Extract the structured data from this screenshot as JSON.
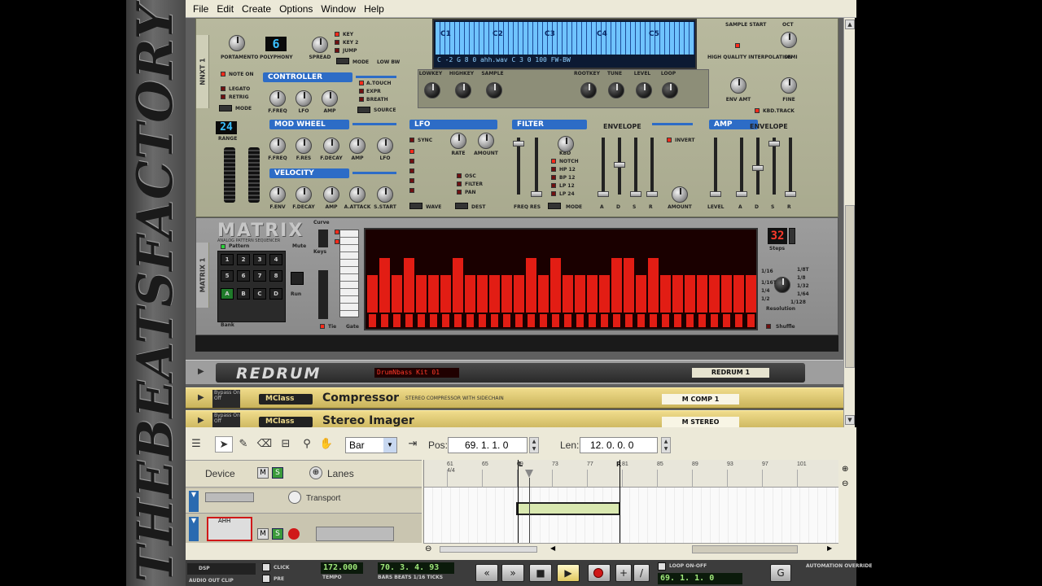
{
  "watermark": "THEBEATSFACTORY",
  "menu": [
    "File",
    "Edit",
    "Create",
    "Options",
    "Window",
    "Help"
  ],
  "nnxt": {
    "side_label": "NNXT 1",
    "knob_labels": [
      "PORTAMENTO",
      "POLYPHONY",
      "SPREAD"
    ],
    "polyphony": "6",
    "key_modes": [
      "KEY",
      "KEY 2",
      "JUMP"
    ],
    "mode_labels": [
      "MODE",
      "LOW BW"
    ],
    "note_on": "NOTE ON",
    "legato": "LEGATO",
    "retrig": "RETRIG",
    "mode": "MODE",
    "controller_title": "CONTROLLER",
    "controller_knobs": [
      "F.FREQ",
      "LFO",
      "AMP"
    ],
    "controller_sources": [
      "A.TOUCH",
      "EXPR",
      "BREATH"
    ],
    "source": "SOURCE",
    "range_value": "24",
    "range_label": "RANGE",
    "modwheel_title": "MOD WHEEL",
    "modwheel_knobs": [
      "F.FREQ",
      "F.RES",
      "F.DECAY",
      "AMP",
      "LFO"
    ],
    "velocity_title": "VELOCITY",
    "velocity_knobs": [
      "F.ENV",
      "F.DECAY",
      "AMP",
      "A.ATTACK",
      "S.START"
    ],
    "keyboard_notes": [
      "C1",
      "C2",
      "C3",
      "C4",
      "C5"
    ],
    "keyboard_readout": "C -2  G 8   0 ahh.wav       C 3  0    100 FW-BW",
    "zone_knobs": [
      "LOWKEY",
      "HIGHKEY",
      "SAMPLE",
      "ROOTKEY",
      "TUNE",
      "LEVEL",
      "LOOP"
    ],
    "sample_start": "SAMPLE START",
    "oct": "OCT",
    "hq": "HIGH QUALITY INTERPOLATION",
    "semi": "SEMI",
    "env_amt": "ENV AMT",
    "fine": "FINE",
    "kbd_track": "KBD.TRACK",
    "lfo_title": "LFO",
    "lfo_sync": "SYNC",
    "lfo_knobs": [
      "RATE",
      "AMOUNT"
    ],
    "lfo_dest": [
      "OSC",
      "FILTER",
      "PAN"
    ],
    "lfo_waves": "WAVE",
    "lfo_dest_label": "DEST",
    "filter_title": "FILTER",
    "filter_envelope": "ENVELOPE",
    "filter_kbd": "KBD",
    "filter_modes": [
      "NOTCH",
      "HP 12",
      "BP 12",
      "LP 12",
      "LP 24"
    ],
    "filter_freq": "FREQ RES",
    "filter_mode": "MODE",
    "invert": "INVERT",
    "adsr": [
      "A",
      "D",
      "S",
      "R"
    ],
    "amount": "AMOUNT",
    "amp_title": "AMP",
    "amp_envelope": "ENVELOPE",
    "level": "LEVEL"
  },
  "matrix": {
    "side_label": "MATRIX 1",
    "logo": "MATRIX",
    "subtitle": "ANALOG PATTERN SEQUENCER",
    "pattern_label": "Pattern",
    "mute_label": "Mute",
    "curve_label": "Curve",
    "keys_label": "Keys",
    "run_label": "Run",
    "bank_label": "Bank",
    "tie_label": "Tie",
    "gate_label": "Gate",
    "pads": [
      "1",
      "2",
      "3",
      "4",
      "5",
      "6",
      "7",
      "8",
      "A",
      "B",
      "C",
      "D"
    ],
    "steps": "32",
    "steps_label": "Steps",
    "resolution_label": "Resolution",
    "shuffle_label": "Shuffle",
    "resolution_values": [
      "1/16",
      "1/8T",
      "1/16T",
      "1/8",
      "1/32",
      "1/4",
      "1/64",
      "1/2",
      "1/128"
    ],
    "column_levels": [
      0.55,
      0.8,
      0.55,
      0.8,
      0.55,
      0.55,
      0.55,
      0.8,
      0.55,
      0.55,
      0.55,
      0.55,
      0.55,
      0.8,
      0.55,
      0.8,
      0.55,
      0.55,
      0.55,
      0.55,
      0.8,
      0.8,
      0.55,
      0.8,
      0.55,
      0.55,
      0.55,
      0.55,
      0.55,
      0.55,
      0.55,
      0.55
    ]
  },
  "redrum": {
    "title": "REDRUM",
    "patch": "DrumNbass Kit 01",
    "tag": "REDRUM 1"
  },
  "mclass": [
    {
      "badge": "MClass",
      "name": "Compressor",
      "desc": "STEREO COMPRESSOR WITH SIDECHAIN",
      "tag": "M COMP 1",
      "bypass": "Bypass On Off"
    },
    {
      "badge": "MClass",
      "name": "Stereo Imager",
      "desc": "",
      "tag": "M STEREO",
      "bypass": "Bypass On Off"
    }
  ],
  "sequencer": {
    "snap_value": "Bar",
    "pos_label": "Pos:",
    "pos_value": "69.  1.  1.    0",
    "len_label": "Len:",
    "len_value": "12.  0.  0.    0",
    "device_label": "Device",
    "lanes_label": "Lanes",
    "transport_track": "Transport",
    "track_name": "AHH",
    "ruler_marks": [
      "61",
      "65",
      "69",
      "73",
      "77",
      "81",
      "85",
      "89",
      "93",
      "97",
      "101"
    ],
    "ruler_sig": "4/4",
    "loop_left": "L",
    "loop_right": "R"
  },
  "transport": {
    "dsp": "DSP",
    "audio_out": "AUDIO OUT CLIP",
    "click": "CLICK",
    "pre": "PRE",
    "tempo": "172.000",
    "tempo_label": "TEMPO",
    "position": "70. 3. 4. 93",
    "position_label": "BARS BEATS 1/16 TICKS",
    "loop_on_off": "LOOP ON-OFF",
    "loop_pos": "69.  1.  1.    0",
    "automation": "AUTOMATION OVERRIDE"
  }
}
